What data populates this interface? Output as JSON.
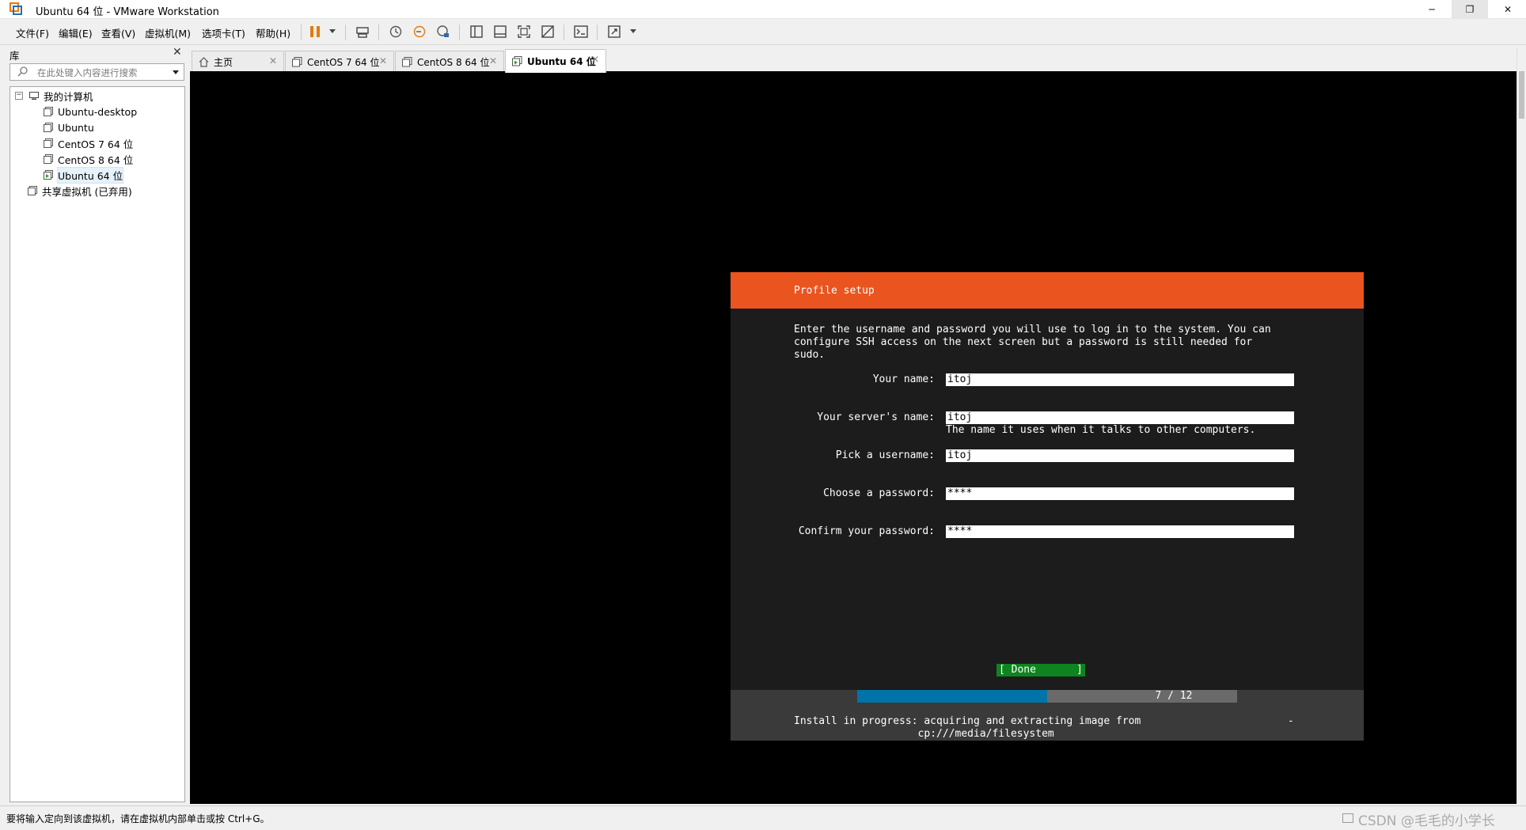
{
  "window": {
    "title": "Ubuntu 64 位 - VMware Workstation",
    "controls": {
      "minimize": "─",
      "maximize": "❐",
      "close": "✕"
    }
  },
  "menu": {
    "items": [
      "文件(F)",
      "编辑(E)",
      "查看(V)",
      "虚拟机(M)",
      "选项卡(T)",
      "帮助(H)"
    ]
  },
  "toolbar": {
    "icons": [
      "pause-icon",
      "send-keys-icon",
      "snapshot-icon",
      "revert-snapshot-icon",
      "snapshot-manager-icon",
      "library-view-icon",
      "thumbnail-view-icon",
      "fullscreen-icon",
      "unity-icon",
      "console-icon",
      "stretch-icon"
    ],
    "accent_color": "#e8790a"
  },
  "library": {
    "title": "库",
    "close": "✕",
    "search_placeholder": "在此处键入内容进行搜索",
    "tree": [
      {
        "label": "我的计算机",
        "level": 0,
        "expander": "−"
      },
      {
        "label": "Ubuntu-desktop",
        "level": 1
      },
      {
        "label": "Ubuntu",
        "level": 1
      },
      {
        "label": "CentOS 7 64 位",
        "level": 1
      },
      {
        "label": "CentOS 8 64 位",
        "level": 1
      },
      {
        "label": "Ubuntu 64 位",
        "level": 1,
        "selected": true,
        "running": true
      },
      {
        "label": "共享虚拟机 (已弃用)",
        "level": 0
      }
    ]
  },
  "tabs": [
    {
      "label": "主页",
      "icon": "home-icon",
      "close": "✕",
      "active": false
    },
    {
      "label": "CentOS 7 64 位",
      "icon": "vm-icon",
      "close": "✕",
      "active": false
    },
    {
      "label": "CentOS 8 64 位",
      "icon": "vm-icon",
      "close": "✕",
      "active": false
    },
    {
      "label": "Ubuntu 64 位",
      "icon": "vm-running-icon",
      "close": "✕",
      "active": true
    }
  ],
  "installer": {
    "header": "Profile setup",
    "header_color": "#e9541f",
    "intro": "Enter the username and password you will use to log in to the system. You can\nconfigure SSH access on the next screen but a password is still needed for\nsudo.",
    "fields": [
      {
        "label": "Your name:",
        "value": "itoj"
      },
      {
        "label": "Your server's name:",
        "value": "itoj",
        "hint": "The name it uses when it talks to other computers."
      },
      {
        "label": "Pick a username:",
        "value": "itoj"
      },
      {
        "label": "Choose a password:",
        "value": "****"
      },
      {
        "label": "Confirm your password:",
        "value": "****"
      }
    ],
    "done_open": "[ Done",
    "done_close": "]",
    "done_color": "#0e8420",
    "progress_text": "7 / 12",
    "progress_fraction": 0.5,
    "progress_color": "#0073a8",
    "status": "Install in progress: acquiring and extracting image from\n                    cp:///media/filesystem",
    "spinner": "-"
  },
  "statusbar": {
    "message": "要将输入定向到该虚拟机，请在虚拟机内部单击或按 Ctrl+G。",
    "watermark": "CSDN @毛毛的小学长"
  }
}
